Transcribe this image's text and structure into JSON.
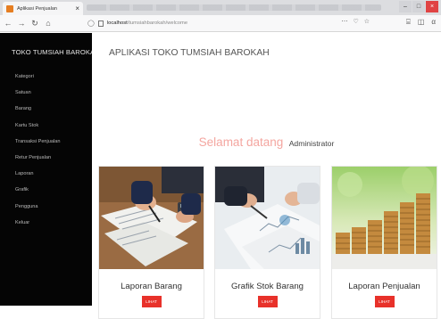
{
  "browser": {
    "tab_title": "Aplikasi Penjualan",
    "tab_close": "×",
    "url_host": "localhost",
    "url_path": "/tumsiahbarokah/welcome",
    "window_controls": [
      "–",
      "□",
      "×"
    ],
    "nav_icons": [
      "back-arrow",
      "forward-arrow",
      "reload",
      "home"
    ]
  },
  "sidebar": {
    "brand": "TOKO TUMSIAH BAROKAH",
    "items": [
      {
        "label": "Kategori"
      },
      {
        "label": "Satuan"
      },
      {
        "label": "Barang"
      },
      {
        "label": "Kartu Stok"
      },
      {
        "label": "Transaksi Penjualan"
      },
      {
        "label": "Retur Penjualan"
      },
      {
        "label": "Laporan"
      },
      {
        "label": "Grafik"
      },
      {
        "label": "Pengguna"
      },
      {
        "label": "Keluar"
      }
    ]
  },
  "main": {
    "app_title": "APLIKASI TOKO TUMSIAH BAROKAH",
    "welcome_greeting": "Selamat datang",
    "welcome_user": "Administrator",
    "cards": [
      {
        "title": "Laporan Barang",
        "button": "LIHAT"
      },
      {
        "title": "Grafik Stok Barang",
        "button": "LIHAT"
      },
      {
        "title": "Laporan Penjualan",
        "button": "LIHAT"
      }
    ]
  },
  "colors": {
    "sidebar_bg": "#050505",
    "accent_button": "#e8312a",
    "welcome_text": "#f4a6a0"
  }
}
